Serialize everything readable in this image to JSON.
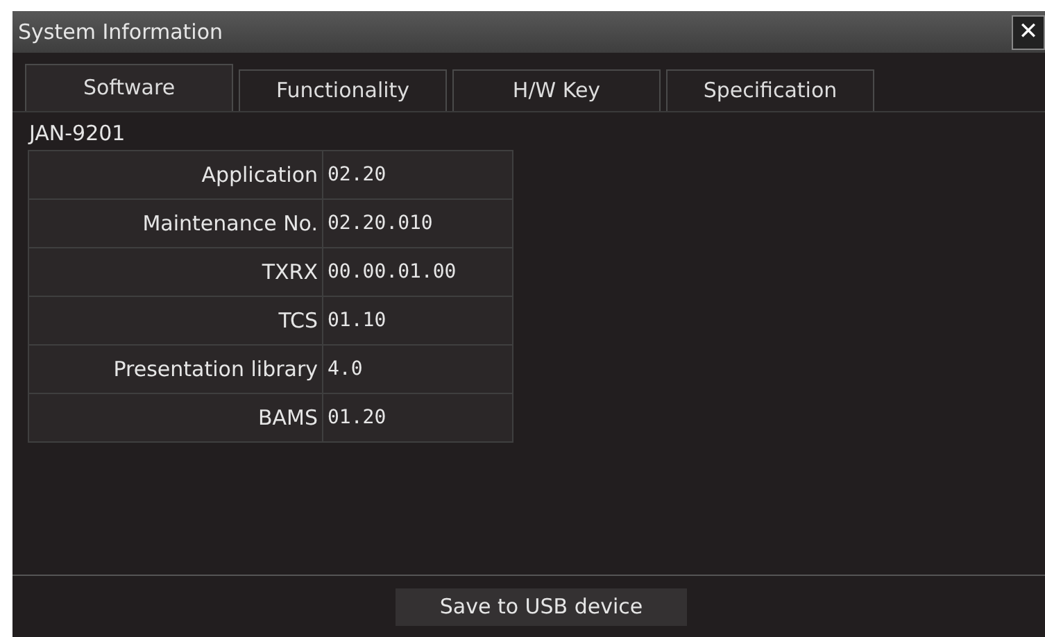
{
  "window": {
    "title": "System Information",
    "close": "✕"
  },
  "tabs": [
    {
      "label": "Software",
      "selected": true
    },
    {
      "label": "Functionality",
      "selected": false
    },
    {
      "label": "H/W Key",
      "selected": false
    },
    {
      "label": "Specification",
      "selected": false
    }
  ],
  "model": "JAN-9201",
  "table": {
    "rows": [
      {
        "label": "Application",
        "value": "02.20"
      },
      {
        "label": "Maintenance No.",
        "value": "02.20.010"
      },
      {
        "label": "TXRX",
        "value": "00.00.01.00"
      },
      {
        "label": "TCS",
        "value": "01.10"
      },
      {
        "label": "Presentation library",
        "value": "4.0"
      },
      {
        "label": "BAMS",
        "value": "01.20"
      }
    ]
  },
  "buttons": [
    "Save to USB device"
  ]
}
